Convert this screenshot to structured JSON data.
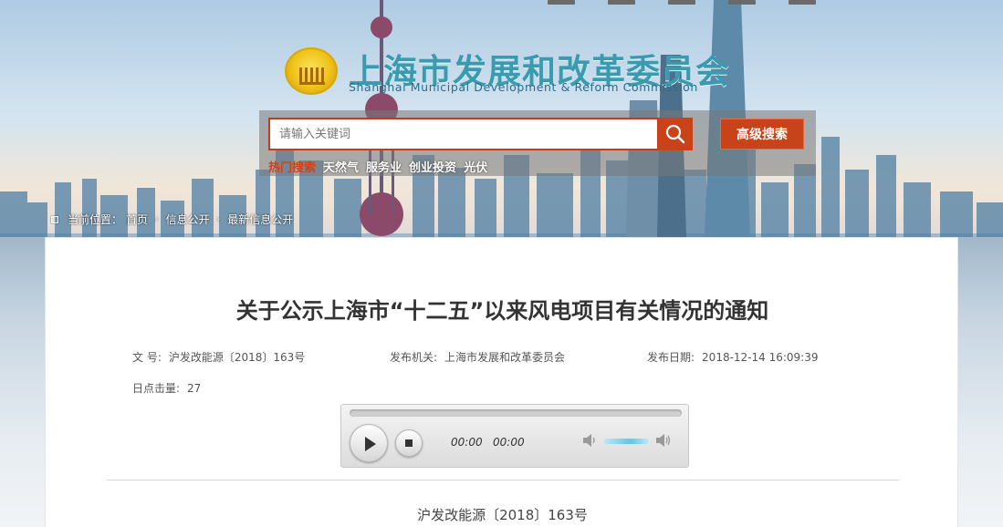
{
  "header": {
    "site_title": "上海市发展和改革委员会",
    "site_subtitle": "Shanghai Municipal Development & Reform Commission"
  },
  "search": {
    "placeholder": "请输入关键词",
    "advanced_label": "高级搜索",
    "hot_label": "热门搜索",
    "hot_items": [
      "天然气",
      "服务业",
      "创业投资",
      "光伏"
    ]
  },
  "breadcrumb": {
    "prefix": "当前位置：",
    "items": [
      "首页",
      "信息公开",
      "最新信息公开"
    ],
    "separator": "›"
  },
  "article": {
    "title": "关于公示上海市“十二五”以来风电项目有关情况的通知",
    "doc_number_label": "文 号:",
    "doc_number": "沪发改能源〔2018〕163号",
    "issuer_label": "发布机关:",
    "issuer": "上海市发展和改革委员会",
    "date_label": "发布日期:",
    "date": "2018-12-14 16:09:39",
    "hits_label": "日点击量:",
    "hits": "27",
    "body_doc_number": "沪发改能源〔2018〕163号"
  },
  "player": {
    "current_time": "00:00",
    "duration": "00:00",
    "progress": 0,
    "volume": 0.6
  },
  "colors": {
    "accent": "#c8421a",
    "logo_text": "#3a9bb0",
    "hot_label": "#d0421b"
  }
}
